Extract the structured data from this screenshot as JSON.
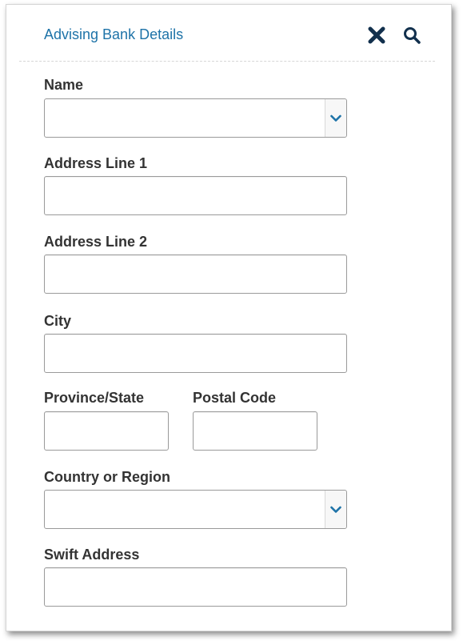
{
  "panel": {
    "title": "Advising Bank Details",
    "accent_color": "#1e73a8",
    "icons": {
      "close": "close-x-icon",
      "search": "search-icon"
    }
  },
  "form": {
    "name": {
      "label": "Name",
      "value": ""
    },
    "address_line_1": {
      "label": "Address Line 1",
      "value": ""
    },
    "address_line_2": {
      "label": "Address Line 2",
      "value": ""
    },
    "city": {
      "label": "City",
      "value": ""
    },
    "province_state": {
      "label": "Province/State",
      "value": ""
    },
    "postal_code": {
      "label": "Postal Code",
      "value": ""
    },
    "country_or_region": {
      "label": "Country or Region",
      "value": ""
    },
    "swift_address": {
      "label": "Swift Address",
      "value": ""
    }
  }
}
